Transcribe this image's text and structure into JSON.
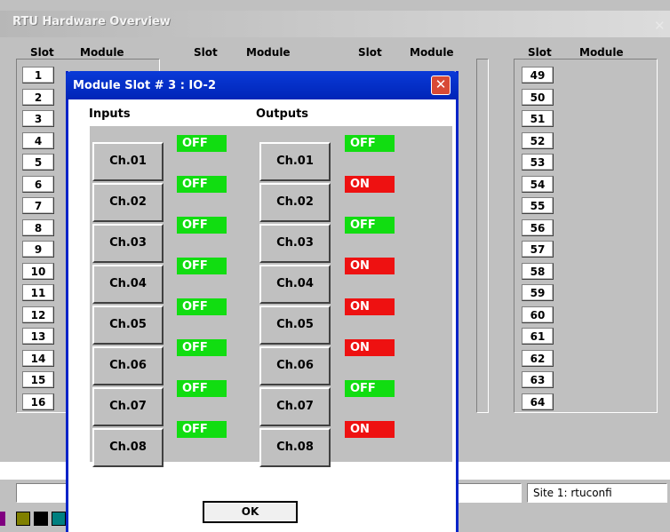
{
  "background_window": {
    "title": "RTU Hardware Overview",
    "column_headers": [
      {
        "slot": "Slot",
        "module": "Module"
      },
      {
        "slot": "Slot",
        "module": "Module"
      },
      {
        "slot": "Slot",
        "module": "Module"
      },
      {
        "slot": "Slot",
        "module": "Module"
      }
    ],
    "slots_col1": [
      "1",
      "2",
      "3",
      "4",
      "5",
      "6",
      "7",
      "8",
      "9",
      "10",
      "11",
      "12",
      "13",
      "14",
      "15",
      "16"
    ],
    "slots_col4": [
      "49",
      "50",
      "51",
      "52",
      "53",
      "54",
      "55",
      "56",
      "57",
      "58",
      "59",
      "60",
      "61",
      "62",
      "63",
      "64"
    ],
    "status_bar": {
      "site_text": "Site 1: rtuconfi"
    }
  },
  "dialog": {
    "title": "Module Slot # 3 : IO-2",
    "inputs_label": "Inputs",
    "outputs_label": "Outputs",
    "inputs": [
      {
        "label": "Ch.01",
        "status": "OFF"
      },
      {
        "label": "Ch.02",
        "status": "OFF"
      },
      {
        "label": "Ch.03",
        "status": "OFF"
      },
      {
        "label": "Ch.04",
        "status": "OFF"
      },
      {
        "label": "Ch.05",
        "status": "OFF"
      },
      {
        "label": "Ch.06",
        "status": "OFF"
      },
      {
        "label": "Ch.07",
        "status": "OFF"
      },
      {
        "label": "Ch.08",
        "status": "OFF"
      }
    ],
    "outputs": [
      {
        "label": "Ch.01",
        "status": "OFF"
      },
      {
        "label": "Ch.02",
        "status": "ON"
      },
      {
        "label": "Ch.03",
        "status": "OFF"
      },
      {
        "label": "Ch.04",
        "status": "ON"
      },
      {
        "label": "Ch.05",
        "status": "ON"
      },
      {
        "label": "Ch.06",
        "status": "ON"
      },
      {
        "label": "Ch.07",
        "status": "OFF"
      },
      {
        "label": "Ch.08",
        "status": "ON"
      }
    ],
    "ok_label": "OK"
  },
  "colors": {
    "on": "#ee1111",
    "off": "#11dd11",
    "title_bar": "#0a3ad8",
    "palette": [
      "#808000",
      "#000000",
      "#008080"
    ]
  },
  "icons": {
    "close": "close-icon",
    "dialog_close": "close-icon"
  }
}
